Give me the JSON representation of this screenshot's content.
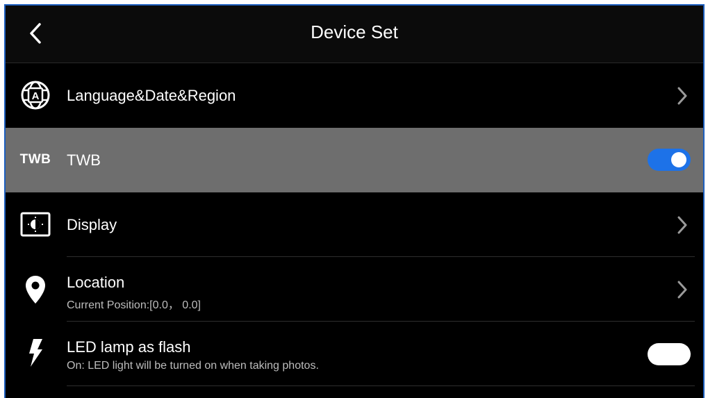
{
  "header": {
    "title": "Device Set",
    "back_icon": "chevron-left-icon"
  },
  "rows": [
    {
      "icon": "globe-language-icon",
      "label": "Language&Date&Region",
      "control": "chevron"
    },
    {
      "icon_text": "TWB",
      "label": "TWB",
      "control": "toggle",
      "toggle_on": true
    },
    {
      "icon": "display-brightness-icon",
      "label": "Display",
      "control": "chevron"
    },
    {
      "icon": "location-pin-icon",
      "label": "Location",
      "sublabel": "Current Position:[0.0， 0.0]",
      "control": "chevron"
    },
    {
      "icon": "flash-icon",
      "label": "LED lamp as flash",
      "sublabel": "On: LED light will be turned on when taking photos.",
      "control": "toggle",
      "toggle_on": false
    }
  ],
  "colors": {
    "accent": "#1d72e8",
    "highlight_row": "#6e6e6e",
    "background": "#000000"
  }
}
